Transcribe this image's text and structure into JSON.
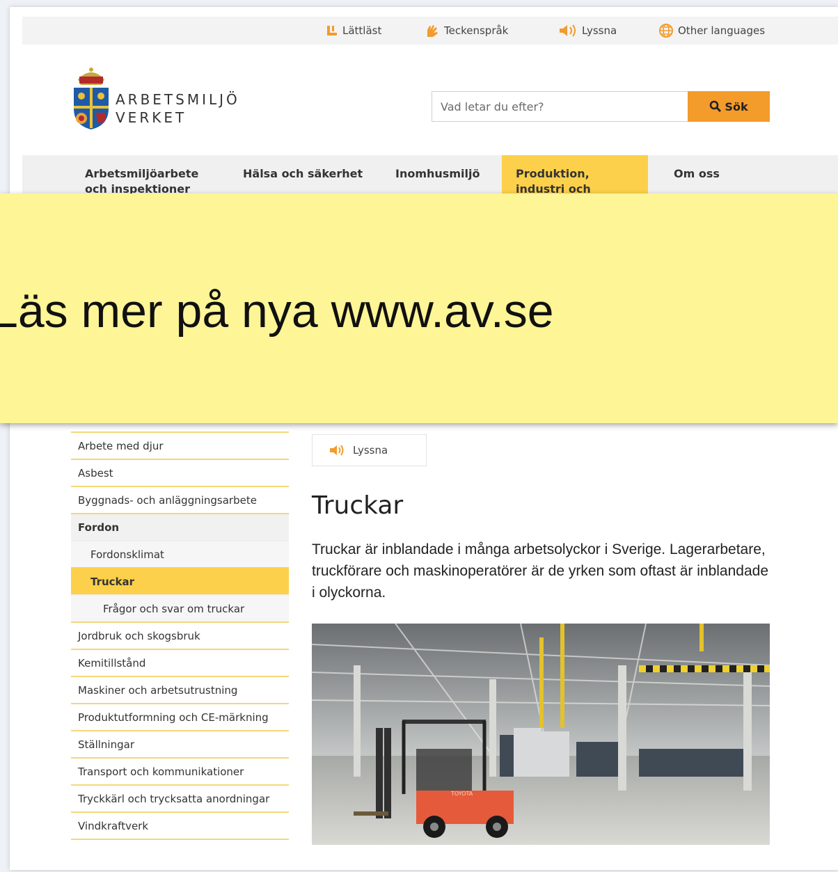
{
  "utility_bar": {
    "items": [
      {
        "label": "Lättläst",
        "icon": "easy-read-icon"
      },
      {
        "label": "Teckenspråk",
        "icon": "sign-language-icon"
      },
      {
        "label": "Lyssna",
        "icon": "speaker-icon"
      },
      {
        "label": "Other languages",
        "icon": "globe-icon"
      }
    ]
  },
  "logo": {
    "line1": "ARBETSMILJÖ",
    "line2": "VERKET"
  },
  "search": {
    "placeholder": "Vad letar du efter?",
    "button_label": "Sök"
  },
  "main_nav": {
    "items": [
      {
        "label": "Arbetsmiljöarbete och inspektioner"
      },
      {
        "label": "Hälsa och säkerhet"
      },
      {
        "label": "Inomhusmiljö"
      },
      {
        "label": "Produktion, industri och logistik",
        "active": true
      },
      {
        "label": "Om oss"
      }
    ]
  },
  "banner": {
    "text": "Läs mer på nya www.av.se"
  },
  "sidebar": {
    "items": [
      {
        "label": "Arbete med djur"
      },
      {
        "label": "Asbest"
      },
      {
        "label": "Byggnads- och anläggningsarbete"
      },
      {
        "label": "Fordon"
      },
      {
        "label": "Fordonsklimat"
      },
      {
        "label": "Truckar"
      },
      {
        "label": "Frågor och svar om truckar"
      },
      {
        "label": "Jordbruk och skogsbruk"
      },
      {
        "label": "Kemitillstånd"
      },
      {
        "label": "Maskiner och arbetsutrustning"
      },
      {
        "label": "Produktutformning och CE-märkning"
      },
      {
        "label": "Ställningar"
      },
      {
        "label": "Transport och kommunikationer"
      },
      {
        "label": "Tryckkärl och trycksatta anordningar"
      },
      {
        "label": "Vindkraftverk"
      }
    ]
  },
  "content": {
    "listen_label": "Lyssna",
    "title": "Truckar",
    "intro": "Truckar är inblandade i många arbetsolyckor i Sverige. Lagerarbetare, truckförare och maskinoperatörer är de yrken som oftast är inblandade i olyckorna.",
    "photo_sign": "TOYOTA"
  },
  "colors": {
    "accent_yellow": "#fcd04a",
    "banner_yellow": "#fef596",
    "search_orange": "#f39b2b",
    "divider_yellow": "#f4d77a"
  }
}
